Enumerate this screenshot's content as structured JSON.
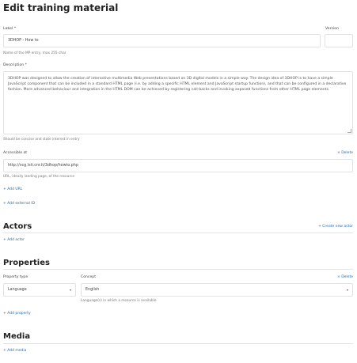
{
  "page": {
    "title": "Edit training material"
  },
  "label_field": {
    "label": "Label *",
    "value": "3DHOP - How to",
    "help": "Name of the MP entry, max 255 char"
  },
  "version_field": {
    "label": "Version",
    "value": ""
  },
  "description_field": {
    "label": "Description *",
    "value": "3DHOP was designed to allow the creation of interactive multimedia Web presentations based on 3D digital models in a simple way. The design idea of 3DHOP is to have a simple JavaScript component that can be included in a standard HTML page (i.e. by adding a specific HTML element and JavaScript startup function), and that can be configured in a declarative fashion. More advanced behaviour and integration in the HTML DOM can be achieved by registering call-backs and invoking exposed functions from other HTML page elements.",
    "help": "Should be concise and state interest in entry"
  },
  "accessible_at": {
    "label": "Accessible at",
    "delete_label": "Delete",
    "value": "http://vcg.isti.cnr.it/3dhop/howto.php",
    "help": "URL, ideally landing page, of the resource",
    "add_url_label": "Add URL"
  },
  "external_id": {
    "add_label": "Add external ID"
  },
  "actors": {
    "heading": "Actors",
    "create_label": "Create new actor",
    "add_label": "Add actor"
  },
  "properties": {
    "heading": "Properties",
    "property_type_label": "Property type",
    "concept_label": "Concept",
    "delete_label": "Delete",
    "property_type_value": "Language",
    "concept_value": "English",
    "concept_help": "Language(s) in which a resource is available",
    "add_label": "Add property"
  },
  "media": {
    "heading": "Media",
    "add_label": "Add media"
  },
  "icons": {
    "plus": "+",
    "delete": "×",
    "caret": "▾",
    "create": "+"
  },
  "colors": {
    "link": "#2b6aa8",
    "border": "#e2e2e2"
  }
}
